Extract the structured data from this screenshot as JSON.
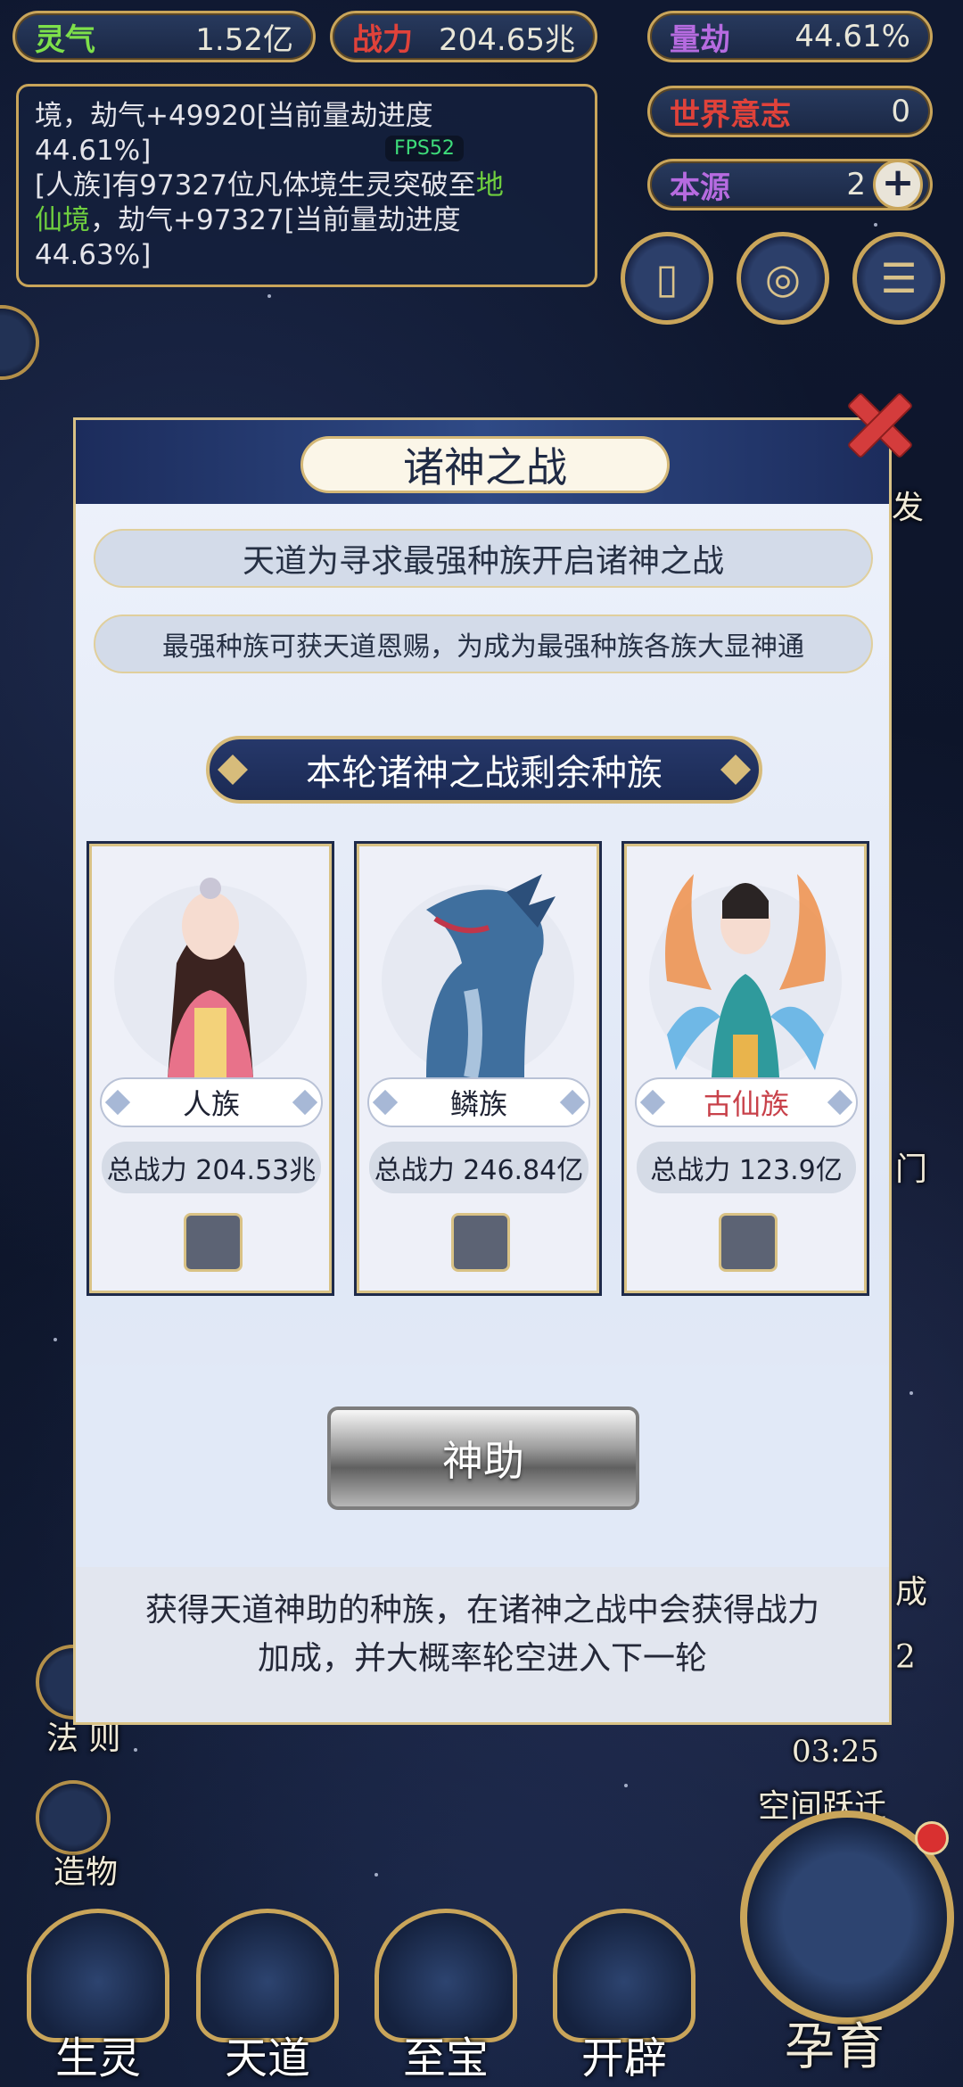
{
  "stats": {
    "lingqi": {
      "label": "灵气",
      "value": "1.52亿",
      "color": "#7ee04a"
    },
    "zhanli": {
      "label": "战力",
      "value": "204.65兆",
      "color": "#e0423a"
    },
    "lianjie": {
      "label": "量劫",
      "value": "44.61%",
      "color": "#b66be0"
    },
    "world_will": {
      "label": "世界意志",
      "value": "0",
      "color": "#e0423a"
    },
    "source": {
      "label": "本源",
      "value": "2",
      "color": "#b66be0"
    }
  },
  "log": {
    "line1": "境，劫气+49920[当前量劫进度",
    "line2": "44.61%]",
    "line3a": "[人族]有97327位凡体境生灵突破至",
    "line3b": "地",
    "line4a": "仙境",
    "line4b": "，劫气+97327[当前量劫进度",
    "line5": "44.63%]",
    "fps": "FPS52"
  },
  "side_labels": {
    "fa": "发",
    "men": "门",
    "cheng": "成",
    "fa_ze": "法 则",
    "zao_wu": "造物",
    "num": "2",
    "timer": "03:25",
    "space_jump": "空间跃迁"
  },
  "bottom_nav": [
    "生灵",
    "天道",
    "至宝",
    "开辟"
  ],
  "big_nav": "孕育",
  "modal": {
    "title": "诸神之战",
    "desc1": "天道为寻求最强种族开启诸神之战",
    "desc2": "最强种族可获天道恩赐，为成为最强种族各族大显神通",
    "section": "本轮诸神之战剩余种族",
    "races": [
      {
        "name": "人族",
        "power": "总战力 204.53兆",
        "name_color": "#1e2232"
      },
      {
        "name": "鳞族",
        "power": "总战力 246.84亿",
        "name_color": "#1e2232"
      },
      {
        "name": "古仙族",
        "power": "总战力 123.9亿",
        "name_color": "#c8414a"
      }
    ],
    "assist_button": "神助",
    "footer_line1": "获得天道神助的种族，在诸神之战中会获得战力",
    "footer_line2": "加成，并大概率轮空进入下一轮"
  }
}
